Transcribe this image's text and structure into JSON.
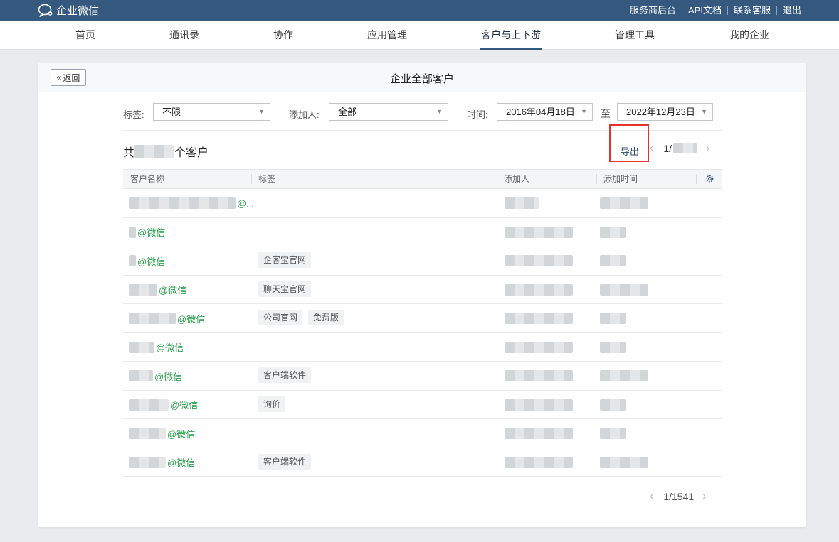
{
  "app": {
    "logo_text": "企业微信",
    "top_links": [
      "服务商后台",
      "API文档",
      "联系客服",
      "退出"
    ]
  },
  "nav": {
    "items": [
      "首页",
      "通讯录",
      "协作",
      "应用管理",
      "客户与上下游",
      "管理工具",
      "我的企业"
    ],
    "active_index": 4
  },
  "page": {
    "back_label": "返回",
    "title": "企业全部客户"
  },
  "filters": {
    "tag_label": "标签:",
    "tag_value": "不限",
    "adder_label": "添加人:",
    "adder_value": "全部",
    "time_label": "时间:",
    "start_date": "2016年04月18日",
    "range_sep": "至",
    "end_date": "2022年12月23日"
  },
  "summary": {
    "prefix": "共",
    "suffix": "个客户"
  },
  "toolbar": {
    "export_label": "导出",
    "pager_top_prefix": "1/",
    "highlight_color": "#e5322d"
  },
  "table": {
    "columns": [
      "客户名称",
      "标签",
      "添加人",
      "添加时间"
    ],
    "rows": [
      {
        "name": "@...",
        "tags": []
      },
      {
        "name": "@微信",
        "tags": []
      },
      {
        "name": "@微信",
        "tags": [
          "企客宝官网"
        ]
      },
      {
        "name": "@微信",
        "tags": [
          "聊天宝官网"
        ]
      },
      {
        "name": "@微信",
        "tags": [
          "公司官网",
          "免费版"
        ]
      },
      {
        "name": "@微信",
        "tags": []
      },
      {
        "name": "@微信",
        "tags": [
          "客户端软件"
        ]
      },
      {
        "name": "@微信",
        "tags": [
          "询价"
        ]
      },
      {
        "name": "@微信",
        "tags": []
      },
      {
        "name": "@微信",
        "tags": [
          "客户端软件"
        ]
      }
    ]
  },
  "pager": {
    "bottom": "1/1541"
  },
  "colors": {
    "topbar": "#35587f",
    "wechat_green": "#2aa14d"
  }
}
